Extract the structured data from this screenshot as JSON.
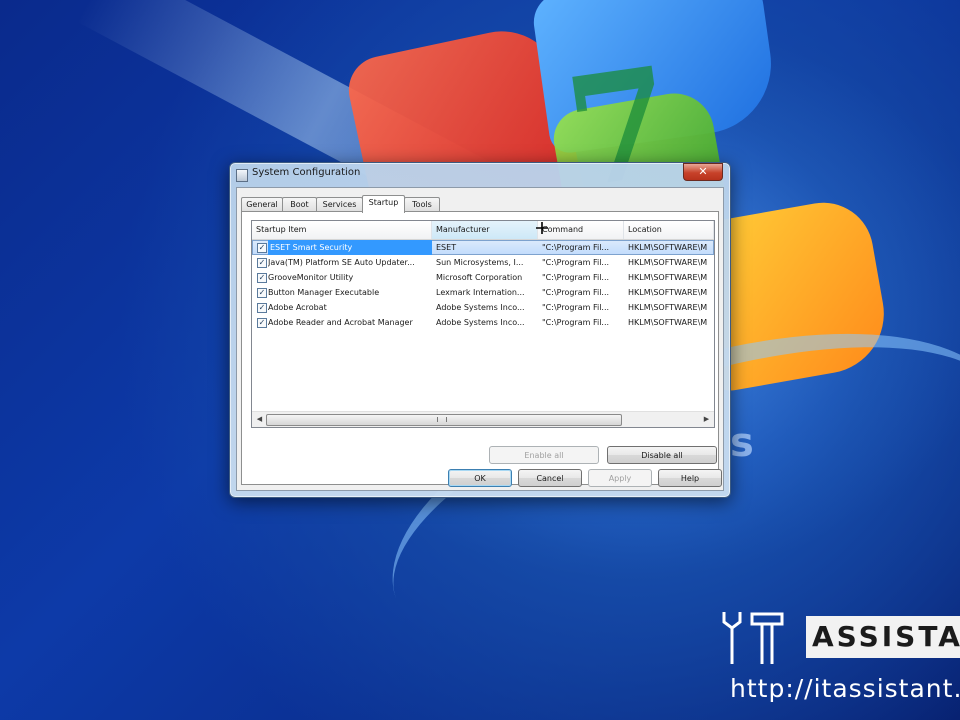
{
  "dialog": {
    "title": "System Configuration",
    "close_glyph": "✕",
    "tabs": [
      {
        "label": "General",
        "active": false
      },
      {
        "label": "Boot",
        "active": false
      },
      {
        "label": "Services",
        "active": false
      },
      {
        "label": "Startup",
        "active": true
      },
      {
        "label": "Tools",
        "active": false
      }
    ],
    "startup": {
      "columns": [
        "Startup Item",
        "Manufacturer",
        "Command",
        "Location"
      ],
      "sorted_column": "Manufacturer",
      "rows": [
        {
          "checked": true,
          "item": "ESET Smart Security",
          "manufacturer": "ESET",
          "command": "\"C:\\Program Fil...",
          "location": "HKLM\\SOFTWARE\\M",
          "selected": true
        },
        {
          "checked": true,
          "item": "Java(TM) Platform SE Auto Updater...",
          "manufacturer": "Sun Microsystems, I...",
          "command": "\"C:\\Program Fil...",
          "location": "HKLM\\SOFTWARE\\M",
          "selected": false
        },
        {
          "checked": true,
          "item": "GrooveMonitor Utility",
          "manufacturer": "Microsoft Corporation",
          "command": "\"C:\\Program Fil...",
          "location": "HKLM\\SOFTWARE\\M",
          "selected": false
        },
        {
          "checked": true,
          "item": "Button Manager Executable",
          "manufacturer": "Lexmark Internation...",
          "command": "\"C:\\Program Fil...",
          "location": "HKLM\\SOFTWARE\\M",
          "selected": false
        },
        {
          "checked": true,
          "item": "Adobe Acrobat",
          "manufacturer": "Adobe Systems Inco...",
          "command": "\"C:\\Program Fil...",
          "location": "HKLM\\SOFTWARE\\M",
          "selected": false
        },
        {
          "checked": true,
          "item": "Adobe Reader and Acrobat Manager",
          "manufacturer": "Adobe Systems Inco...",
          "command": "\"C:\\Program Fil...",
          "location": "HKLM\\SOFTWARE\\M",
          "selected": false
        }
      ],
      "enable_all_label": "Enable all",
      "disable_all_label": "Disable all"
    },
    "footer": {
      "ok_label": "OK",
      "cancel_label": "Cancel",
      "apply_label": "Apply",
      "help_label": "Help"
    }
  },
  "desktop": {
    "os_digit": "7",
    "os_letter": "s"
  },
  "watermark": {
    "brand": "ASSISTAN",
    "url": "http://itassistant.o"
  },
  "scrollbar": {
    "left_arrow": "◀",
    "right_arrow": "▶"
  }
}
